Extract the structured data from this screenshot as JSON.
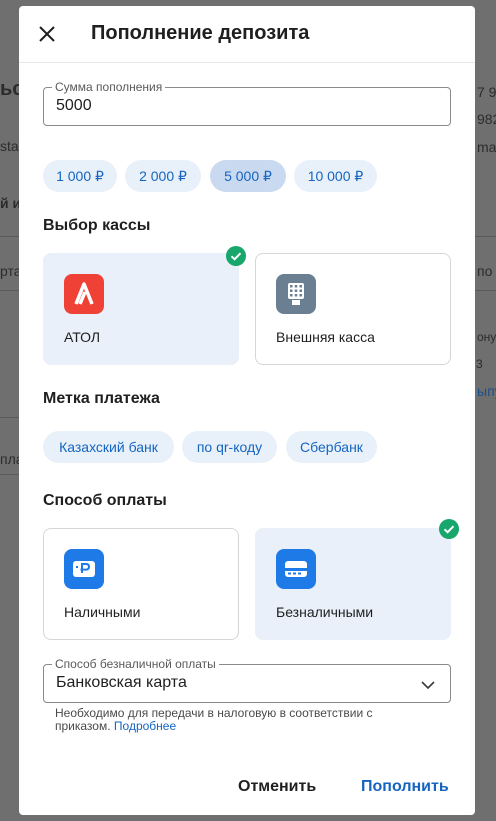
{
  "background": {
    "fragments": [
      "ьс",
      "7 9",
      "sta",
      "982",
      "ma",
      "й и",
      "рта",
      "по",
      "ону",
      "3",
      "ыпу",
      "пла"
    ]
  },
  "dialog": {
    "title": "Пополнение депозита",
    "close_icon": "close-icon"
  },
  "amount": {
    "label": "Сумма пополнения",
    "value": "5000"
  },
  "presets": [
    {
      "label": "1 000 ₽",
      "selected": false
    },
    {
      "label": "2 000 ₽",
      "selected": false
    },
    {
      "label": "5 000 ₽",
      "selected": true
    },
    {
      "label": "10 000 ₽",
      "selected": false
    }
  ],
  "cashbox": {
    "title": "Выбор кассы",
    "options": [
      {
        "label": "АТОЛ",
        "icon": "atol-logo-icon",
        "color": "#f04137",
        "selected": true
      },
      {
        "label": "Внешняя касса",
        "icon": "cash-register-icon",
        "color": "#6b7f93",
        "selected": false
      }
    ]
  },
  "payment_tag": {
    "title": "Метка платежа",
    "tags": [
      "Казахский банк",
      "по qr-коду",
      "Сбербанк"
    ]
  },
  "payment_method": {
    "title": "Способ оплаты",
    "options": [
      {
        "label": "Наличными",
        "icon": "cash-icon",
        "color": "#1e7ae6",
        "selected": false
      },
      {
        "label": "Безналичными",
        "icon": "card-icon",
        "color": "#1e7ae6",
        "selected": true
      }
    ]
  },
  "cashless_method": {
    "label": "Способ безналичной оплаты",
    "value": "Банковская карта",
    "helper": "Необходимо для передачи в налоговую в соответствии с приказом.",
    "link": "Подробнее"
  },
  "actions": {
    "cancel": "Отменить",
    "submit": "Пополнить"
  },
  "colors": {
    "accent": "#1565c0",
    "check": "#17a66c",
    "chip_bg": "#e8f0fa",
    "chip_selected_bg": "#c9daf0"
  }
}
